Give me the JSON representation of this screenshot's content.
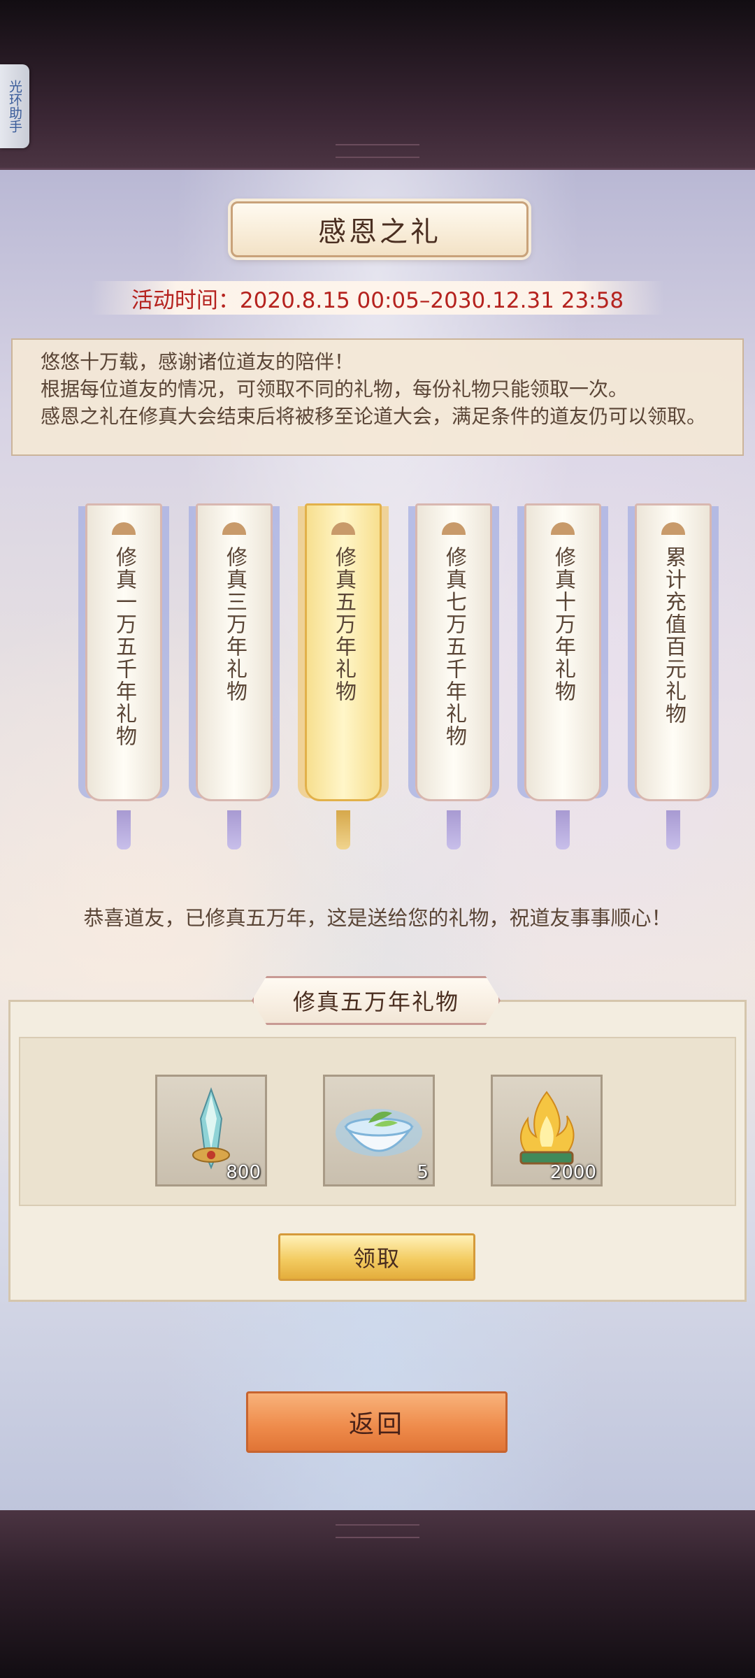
{
  "side_helper": {
    "label": "光环助手"
  },
  "header": {
    "title": "感恩之礼",
    "time": "活动时间：2020.8.15 00:05–2030.12.31 23:58"
  },
  "description": {
    "line1": "悠悠十万载，感谢诸位道友的陪伴！",
    "line2": "根据每位道友的情况，可领取不同的礼物，每份礼物只能领取一次。",
    "line3": "感恩之礼在修真大会结束后将被移至论道大会，满足条件的道友仍可以领取。"
  },
  "banners": [
    {
      "label": "修真一万五千年礼物",
      "selected": false
    },
    {
      "label": "修真三万年礼物",
      "selected": false
    },
    {
      "label": "修真五万年礼物",
      "selected": true
    },
    {
      "label": "修真七万五千年礼物",
      "selected": false
    },
    {
      "label": "修真十万年礼物",
      "selected": false
    },
    {
      "label": "累计充值百元礼物",
      "selected": false
    }
  ],
  "congrats": "恭喜道友，已修真五万年，这是送给您的礼物，祝道友事事顺心！",
  "gift": {
    "title": "修真五万年礼物",
    "items": [
      {
        "icon": "crystal-sword-icon",
        "count": "800"
      },
      {
        "icon": "tea-bowl-icon",
        "count": "5"
      },
      {
        "icon": "golden-flame-icon",
        "count": "2000"
      }
    ],
    "claim_label": "领取"
  },
  "back_label": "返回",
  "colors": {
    "accent_red": "#b5221e",
    "claim_gold": "#f3cc62",
    "back_orange": "#ee8a4a",
    "frame_dark": "#3a2634"
  }
}
